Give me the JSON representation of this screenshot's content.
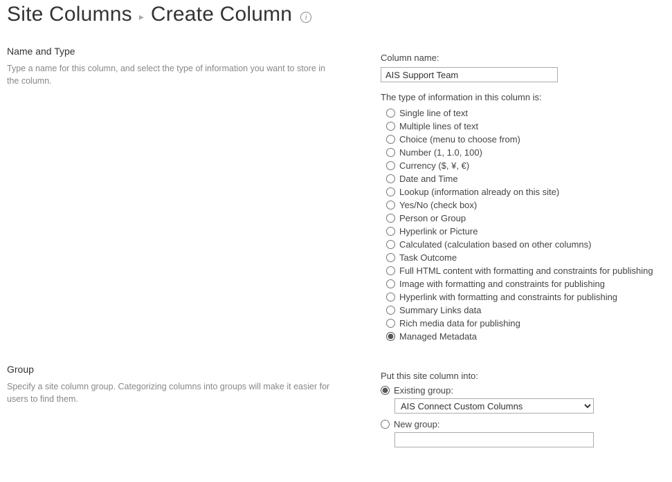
{
  "breadcrumb": {
    "parent": "Site Columns",
    "current": "Create Column"
  },
  "nameType": {
    "heading": "Name and Type",
    "description": "Type a name for this column, and select the type of information you want to store in the column.",
    "columnNameLabel": "Column name:",
    "columnNameValue": "AIS Support Team",
    "typeLabel": "The type of information in this column is:",
    "options": [
      "Single line of text",
      "Multiple lines of text",
      "Choice (menu to choose from)",
      "Number (1, 1.0, 100)",
      "Currency ($, ¥, €)",
      "Date and Time",
      "Lookup (information already on this site)",
      "Yes/No (check box)",
      "Person or Group",
      "Hyperlink or Picture",
      "Calculated (calculation based on other columns)",
      "Task Outcome",
      "Full HTML content with formatting and constraints for publishing",
      "Image with formatting and constraints for publishing",
      "Hyperlink with formatting and constraints for publishing",
      "Summary Links data",
      "Rich media data for publishing",
      "Managed Metadata"
    ],
    "selectedIndex": 17
  },
  "group": {
    "heading": "Group",
    "description": "Specify a site column group. Categorizing columns into groups will make it easier for users to find them.",
    "putIntoLabel": "Put this site column into:",
    "existingLabel": "Existing group:",
    "existingValue": "AIS Connect Custom Columns",
    "newLabel": "New group:",
    "newValue": "",
    "selected": "existing"
  }
}
